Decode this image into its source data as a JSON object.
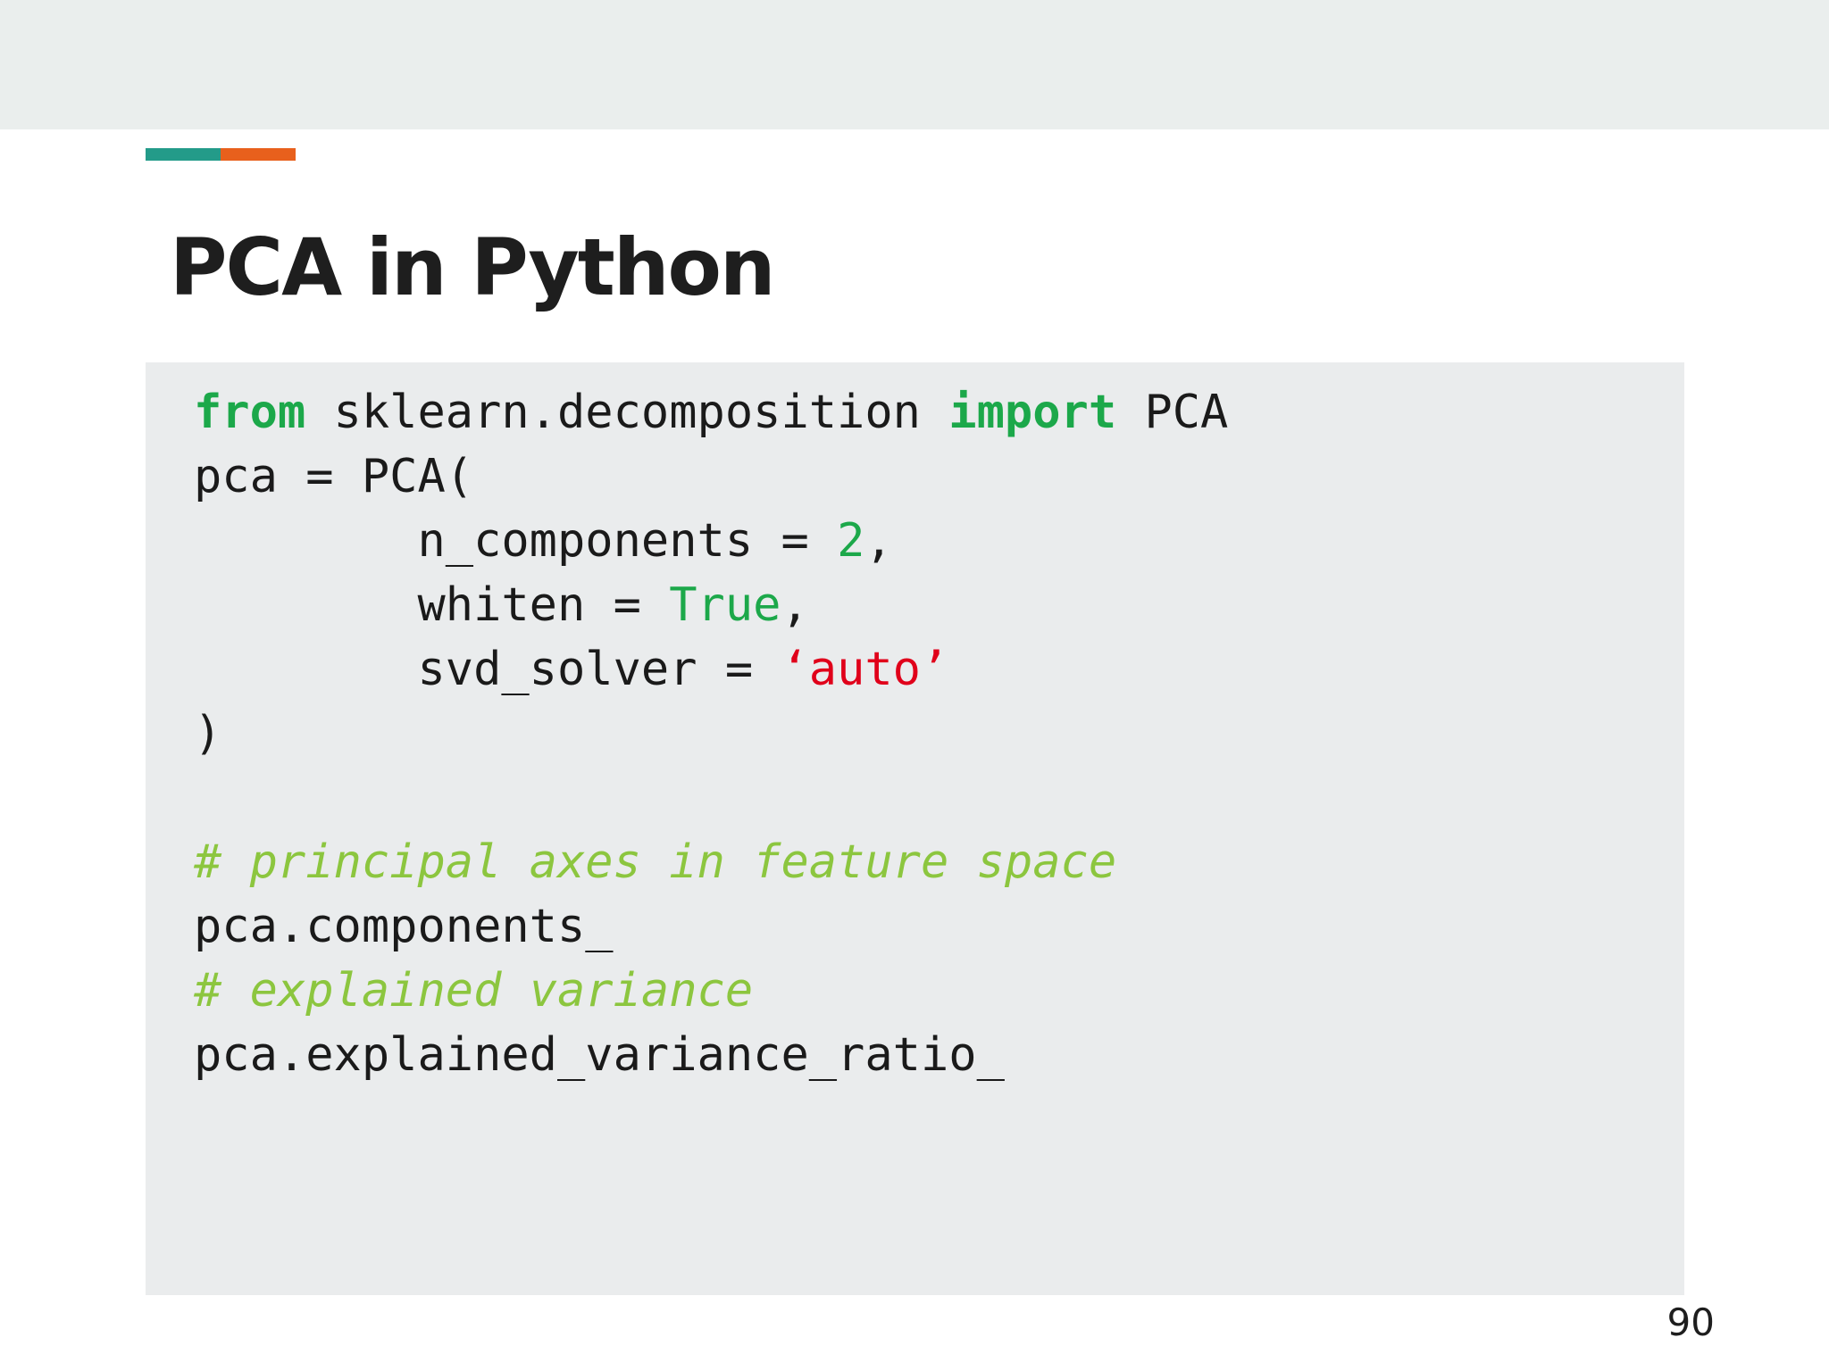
{
  "colors": {
    "keyword": "#1ca84a",
    "literal": "#1ca84a",
    "string": "#e0001a",
    "comment": "#8cc63f",
    "accent_teal": "#239b89",
    "accent_orange": "#e8601c"
  },
  "slide": {
    "title": "PCA in Python",
    "page_number": "90"
  },
  "code": {
    "line1": {
      "kw1": "from",
      "mod": " sklearn.decomposition ",
      "kw2": "import",
      "name": " PCA"
    },
    "line2": "pca = PCA(",
    "line3": {
      "param": "        n_components = ",
      "value": "2",
      "end": ","
    },
    "line4": {
      "param": "        whiten = ",
      "value": "True",
      "end": ","
    },
    "line5": {
      "param": "        svd_solver = ",
      "value": "‘auto’"
    },
    "line6": ")",
    "comment1": "# principal axes in feature space",
    "line8": "pca.components_",
    "comment2": "# explained variance",
    "line10": "pca.explained_variance_ratio_"
  }
}
